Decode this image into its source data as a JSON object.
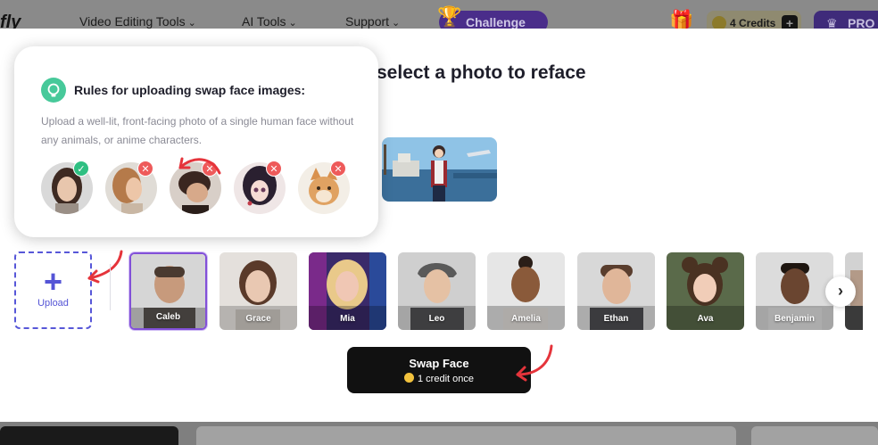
{
  "nav": {
    "logo": "fly",
    "items": [
      {
        "label": "Video Editing Tools"
      },
      {
        "label": "AI Tools"
      },
      {
        "label": "Support"
      }
    ],
    "challenge": "Challenge",
    "credits": "4 Credits",
    "credits_plus": "+",
    "pro": "PRO"
  },
  "modal": {
    "headline": "select a photo to reface"
  },
  "rules": {
    "title": "Rules for uploading swap face images:",
    "description": "Upload a well-lit, front-facing photo of a single human face without any animals, or anime characters.",
    "samples": [
      {
        "status": "ok",
        "icon": "check-icon"
      },
      {
        "status": "no",
        "icon": "x-icon"
      },
      {
        "status": "no",
        "icon": "x-icon"
      },
      {
        "status": "no",
        "icon": "x-icon"
      },
      {
        "status": "no",
        "icon": "x-icon"
      }
    ]
  },
  "upload": {
    "icon": "+",
    "label": "Upload"
  },
  "faces": [
    {
      "name": "Caleb",
      "selected": true
    },
    {
      "name": "Grace"
    },
    {
      "name": "Mia"
    },
    {
      "name": "Leo"
    },
    {
      "name": "Amelia"
    },
    {
      "name": "Ethan"
    },
    {
      "name": "Ava"
    },
    {
      "name": "Benjamin"
    }
  ],
  "next_icon": "›",
  "swap": {
    "label": "Swap Face",
    "sub": "1 credit once"
  },
  "colors": {
    "accent": "#5454d6",
    "selected_border": "#8250d8",
    "arrow": "#e5343b",
    "ok": "#2fbf82",
    "no": "#ee5a5a",
    "button": "#111111"
  }
}
